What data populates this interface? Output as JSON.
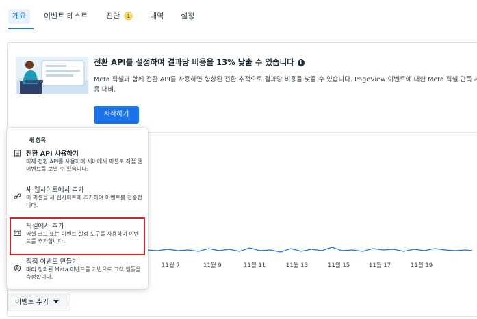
{
  "tabs": [
    {
      "label": "개요",
      "active": true
    },
    {
      "label": "이벤트 테스트"
    },
    {
      "label": "진단",
      "badge": "1"
    },
    {
      "label": "내역"
    },
    {
      "label": "설정"
    }
  ],
  "promo": {
    "title": "전환 API를 설정하여 결과당 비용을 13% 낮출 수 있습니다",
    "info_icon": "i",
    "description": "Meta 픽셀과 함께 전환 API를 사용하면 향상된 전환 추적으로 결과당 비용을 낮출 수 있습니다. PageView 이벤트에 대한 Meta 픽셀 단독 사용 대비.",
    "start_button": "시작하기"
  },
  "chart_data": {
    "type": "line",
    "x_labels": [
      "11월 7",
      "11월 9",
      "11월 11",
      "11월 13",
      "11월 15",
      "11월 17",
      "11월 19"
    ]
  },
  "dropdown": {
    "header": "새 항목",
    "items": [
      {
        "title": "전환 API 사용하기",
        "description": "이제 전환 API를 사용하여 서버에서 픽셀로 직접 웹 이벤트를 보낼 수 있습니다.",
        "icon": "server-icon"
      },
      {
        "title": "새 웹사이트에서 추가",
        "description": "이 픽셀을 새 웹사이트에 추가하여 이벤트를 전송합니다.",
        "icon": "link-icon"
      },
      {
        "title": "픽셀에서 추가",
        "description": "픽셀 코드 또는 이벤트 설정 도구를 사용하여 이벤트를 추가합니다.",
        "icon": "code-icon"
      },
      {
        "title": "직접 이벤트 만들기",
        "description": "미리 정의된 Meta 이벤트를 기반으로 고객 행동을 측정합니다.",
        "icon": "gear-icon"
      }
    ]
  },
  "add_event_button": "이벤트 추가",
  "colors": {
    "accent": "#1a73e8",
    "highlight": "#e01b24",
    "badge": "#f7d866"
  }
}
